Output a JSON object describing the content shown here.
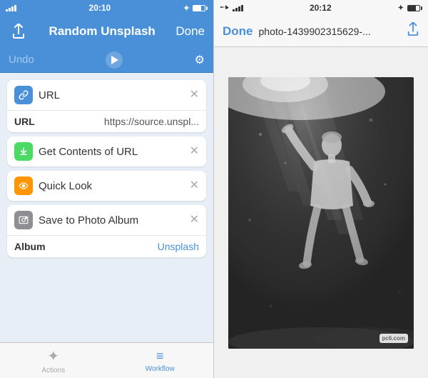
{
  "left": {
    "statusBar": {
      "time": "20:10",
      "signal": "signal",
      "wifi": "wifi",
      "bluetooth": "BT",
      "battery": "battery"
    },
    "navBar": {
      "title": "Random Unsplash",
      "doneLabel": "Done"
    },
    "toolbar": {
      "undoLabel": "Undo"
    },
    "actions": [
      {
        "id": "url",
        "iconType": "icon-blue",
        "iconSymbol": "🔗",
        "title": "URL",
        "hasBody": true,
        "bodyLabel": "URL",
        "bodyValue": "https://source.unspl..."
      },
      {
        "id": "get-contents",
        "iconType": "icon-green",
        "iconSymbol": "↓",
        "title": "Get Contents of URL",
        "hasBody": false
      },
      {
        "id": "quick-look",
        "iconType": "icon-orange",
        "iconSymbol": "👁",
        "title": "Quick Look",
        "hasBody": false
      },
      {
        "id": "save-photo",
        "iconType": "icon-gray",
        "iconSymbol": "📷",
        "title": "Save to Photo Album",
        "hasBody": true,
        "bodyLabel": "Album",
        "bodyValue": "Unsplash",
        "bodyValueType": "link"
      }
    ],
    "tabBar": {
      "tabs": [
        {
          "id": "actions",
          "label": "Actions",
          "icon": "✦",
          "active": false
        },
        {
          "id": "workflow",
          "label": "Workflow",
          "icon": "≡",
          "active": true
        }
      ]
    }
  },
  "right": {
    "statusBar": {
      "time": "20:12",
      "signal": "signal",
      "wifi": "wifi",
      "bluetooth": "BT",
      "battery": "battery"
    },
    "navBar": {
      "doneLabel": "Done",
      "title": "photo-1439902315629-...",
      "shareIcon": "share"
    },
    "photo": {
      "altText": "Underwater black and white photo",
      "watermark": "pc6.com"
    }
  }
}
